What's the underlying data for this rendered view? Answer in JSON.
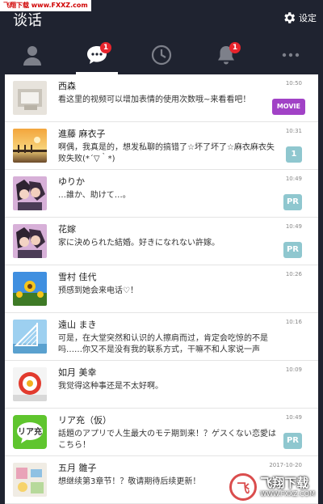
{
  "watermark_top": "飞翔下载 www.FXXZ.com",
  "header": {
    "title": "谈话",
    "settings_label": "设定"
  },
  "tabs": [
    {
      "name": "friends",
      "icon": "person-icon",
      "badge": ""
    },
    {
      "name": "chats",
      "icon": "chat-bubble-icon",
      "badge": "1"
    },
    {
      "name": "history",
      "icon": "clock-icon",
      "badge": ""
    },
    {
      "name": "notifications",
      "icon": "bell-icon",
      "badge": "1"
    },
    {
      "name": "more",
      "icon": "more-dots-icon",
      "badge": ""
    }
  ],
  "chats": [
    {
      "name": "西森",
      "time": "10:50",
      "message": "看这里的视频可以增加表情的使用次数哦~来看看吧！",
      "tag": "MOVIE",
      "avatar": "photo"
    },
    {
      "name": "進藤 麻衣子",
      "time": "10:31",
      "message": "啊偶，我真是的，想发私聊的搞错了☆坏了坏了☆麻衣麻衣失败失败(*´▽｀*)",
      "tag": "1",
      "avatar": "sunset"
    },
    {
      "name": "ゆりか",
      "time": "10:49",
      "message": "…誰か、助けて…。",
      "tag": "PR",
      "avatar": "anime"
    },
    {
      "name": "花嫁",
      "time": "10:49",
      "message": "家に決められた結婚。好きになれない許嫁。",
      "tag": "PR",
      "avatar": "anime"
    },
    {
      "name": "雪村 佳代",
      "time": "10:26",
      "message": "预感到她会来电话♡！",
      "tag": "",
      "avatar": "sunflower"
    },
    {
      "name": "遠山 まき",
      "time": "10:16",
      "message": "可是，在大堂突然和认识的人擦肩而过，肯定会吃惊的不是吗……你又不是没有我的联系方式，干嘛不和人家说一声",
      "tag": "",
      "avatar": "bridge"
    },
    {
      "name": "如月 美幸",
      "time": "10:09",
      "message": "我觉得这种事还是不太好啊。",
      "tag": "",
      "avatar": "egg"
    },
    {
      "name": "リア充（仮）",
      "time": "10:49",
      "message": "話題のアプリで人生最大のモテ期到来！？ゲスくない恋愛はこちら！",
      "tag": "PR",
      "avatar": "riaju"
    },
    {
      "name": "五月 雛子",
      "time": "2017-10-20",
      "message": "想继续第3章节！？敬请期待后续更新！",
      "tag": "",
      "avatar": "crafts"
    }
  ],
  "watermark_bottom": {
    "mark": "飞",
    "title": "飞翔下载",
    "url": "WWW.FXXZ.COM"
  },
  "colors": {
    "header_bg": "#1f2330",
    "badge": "#e8242c",
    "movie_tag": "#a142c6",
    "pr_tag": "#8fc7cf"
  }
}
